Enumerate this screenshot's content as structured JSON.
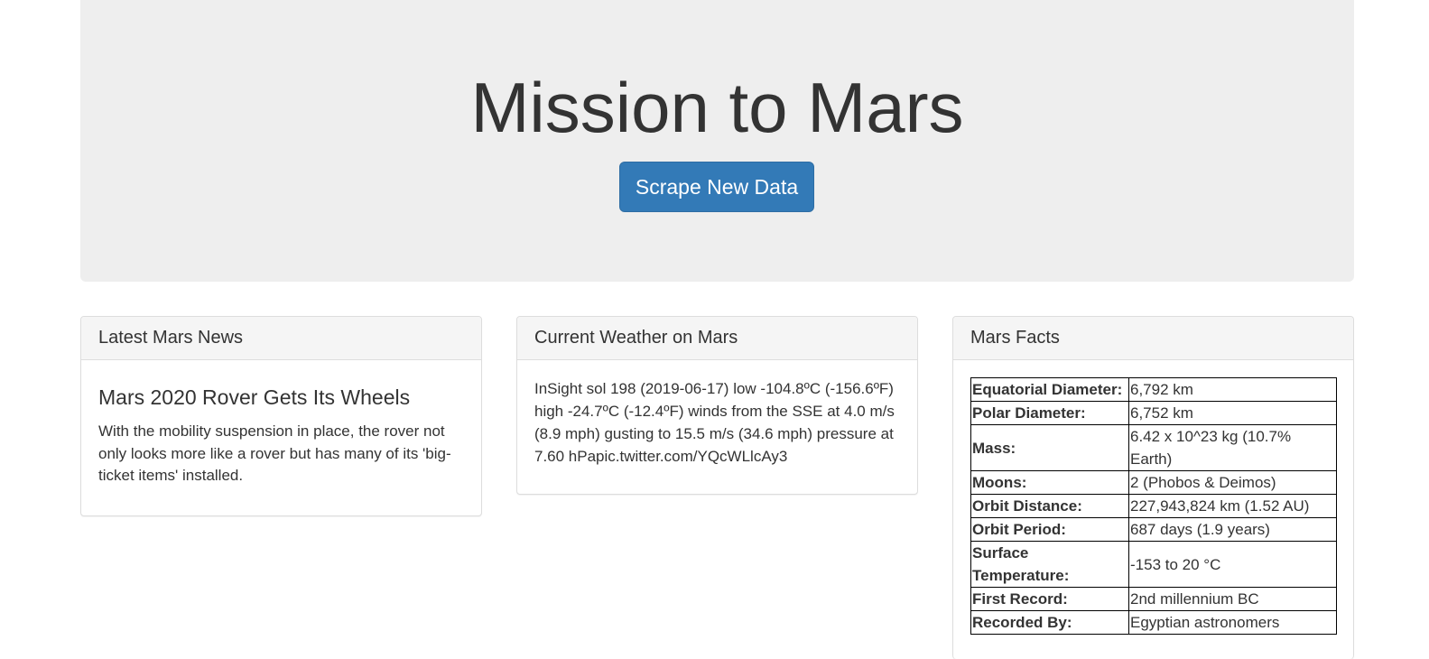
{
  "header": {
    "title": "Mission to Mars",
    "scrape_button": "Scrape New Data"
  },
  "news": {
    "heading": "Latest Mars News",
    "title": "Mars 2020 Rover Gets Its Wheels",
    "body": "With the mobility suspension in place, the rover not only looks more like a rover but has many of its 'big-ticket items' installed."
  },
  "weather": {
    "heading": "Current Weather on Mars",
    "text": "InSight sol 198 (2019-06-17) low -104.8ºC (-156.6ºF) high -24.7ºC (-12.4ºF) winds from the SSE at 4.0 m/s (8.9 mph) gusting to 15.5 m/s (34.6 mph) pressure at 7.60 hPapic.twitter.com/YQcWLlcAy3"
  },
  "facts": {
    "heading": "Mars Facts",
    "rows": [
      {
        "label": "Equatorial Diameter:",
        "value": "6,792 km"
      },
      {
        "label": "Polar Diameter:",
        "value": "6,752 km"
      },
      {
        "label": "Mass:",
        "value": "6.42 x 10^23 kg (10.7% Earth)"
      },
      {
        "label": "Moons:",
        "value": "2 (Phobos & Deimos)"
      },
      {
        "label": "Orbit Distance:",
        "value": "227,943,824 km (1.52 AU)"
      },
      {
        "label": "Orbit Period:",
        "value": "687 days (1.9 years)"
      },
      {
        "label": "Surface Temperature:",
        "value": "-153 to 20 °C"
      },
      {
        "label": "First Record:",
        "value": "2nd millennium BC"
      },
      {
        "label": "Recorded By:",
        "value": "Egyptian astronomers"
      }
    ]
  }
}
